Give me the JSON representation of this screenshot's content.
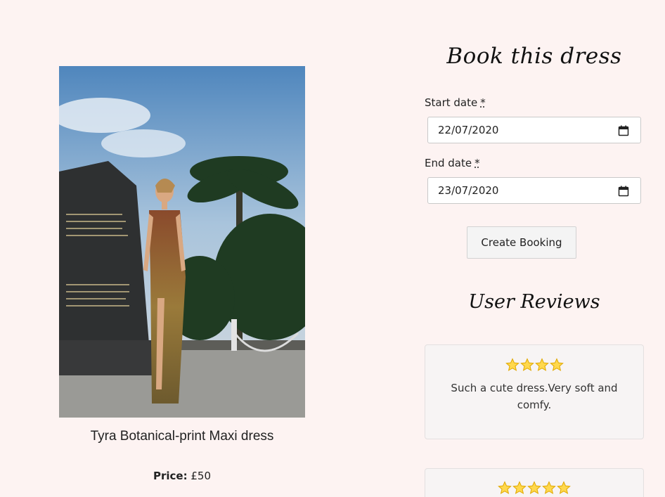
{
  "product": {
    "name": "Tyra Botanical-print Maxi dress",
    "price_label": "Price:",
    "price_value": "£50"
  },
  "booking": {
    "title": "Book this dress",
    "start_label": "Start date",
    "start_value": "22/07/2020",
    "end_label": "End date",
    "end_value": "23/07/2020",
    "required_mark": "*",
    "button_label": "Create Booking"
  },
  "reviews": {
    "title": "User Reviews",
    "items": [
      {
        "rating": 4,
        "text": "Such a cute dress.Very soft and comfy."
      },
      {
        "rating": 5,
        "text": ""
      }
    ]
  },
  "icons": {
    "calendar": "calendar-icon",
    "star": "star-icon"
  },
  "colors": {
    "page_background": "#fdf3f2",
    "star_fill": "#ffd84d",
    "star_outline": "#e0a800"
  }
}
